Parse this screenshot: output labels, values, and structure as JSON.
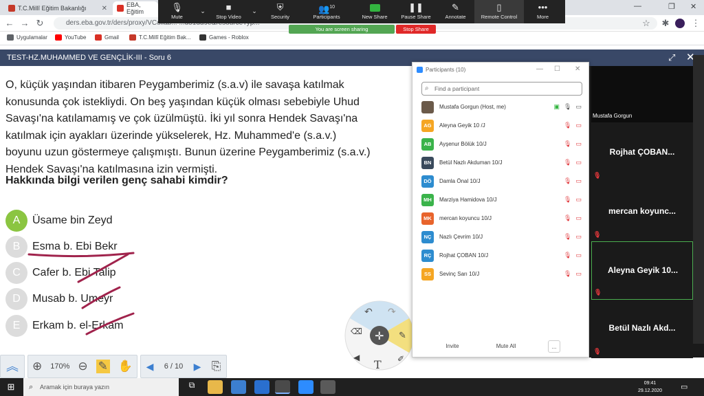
{
  "browser": {
    "tabs": [
      {
        "label": "T.C.Millî Eğitim Bakanlığı",
        "color": "#c53929"
      },
      {
        "label": "EBA, Eğitim",
        "color": "#d93025"
      }
    ],
    "url": "ders.eba.gov.tr/ders/proxy/VCollab...   ...d51dd9e&resourceTyp...",
    "bookmarks": [
      {
        "label": "Uygulamalar",
        "color": "#5f6368"
      },
      {
        "label": "YouTube",
        "color": "#ff0000"
      },
      {
        "label": "Gmail",
        "color": "#d93025"
      },
      {
        "label": "T.C.Millî Eğitim Bak...",
        "color": "#c53929"
      },
      {
        "label": "Games - Roblox",
        "color": "#333333"
      }
    ]
  },
  "zoom": {
    "toolbar": [
      {
        "label": "Mute",
        "icon": "🎙"
      },
      {
        "label": "Stop Video",
        "icon": "▶"
      },
      {
        "label": "Security",
        "icon": "🛡"
      },
      {
        "label": "Participants",
        "icon": "👥",
        "count": "10"
      },
      {
        "label": "New Share",
        "icon": "share"
      },
      {
        "label": "Pause Share",
        "icon": "❚❚"
      },
      {
        "label": "Annotate",
        "icon": "✎"
      },
      {
        "label": "Remote Control",
        "icon": "🖱"
      },
      {
        "label": "More",
        "icon": "•••"
      }
    ],
    "sharing_text": "You are screen sharing",
    "stop_share": "Stop Share"
  },
  "quiz": {
    "title": "TEST-HZ.MUHAMMED VE GENÇLİK-III - Soru 6",
    "question_lines": [
      "O, küçük yaşından itibaren Peygamberimiz (s.a.v) ile savaşa katılmak",
      "konusunda çok istekliydi. On beş yaşından küçük olması sebebiyle Uhud",
      "Savaşı'na katılamamış ve çok üzülmüştü. İki yıl sonra Hendek Savaşı'na",
      "katılmak için ayakları üzerinde yükselerek, Hz. Muhammed'e (s.a.v.)",
      "boyunu uzun göstermeye çalışmıştı. Bunun üzerine Peygamberimiz (s.a.v.)",
      "Hendek Savaşı'na katılmasına izin vermişti."
    ],
    "question_bold": "Hakkında bilgi verilen genç sahabi kimdir?",
    "options": [
      {
        "letter": "A",
        "text": "Üsame bin Zeyd",
        "selected": true
      },
      {
        "letter": "B",
        "text": "Esma b. Ebi Bekr",
        "selected": false
      },
      {
        "letter": "C",
        "text": "Cafer b. Ebi Talip",
        "selected": false
      },
      {
        "letter": "D",
        "text": "Musab b. Umeyr",
        "selected": false
      },
      {
        "letter": "E",
        "text": "Erkam b. el-Erkam",
        "selected": false
      }
    ],
    "annotation_color": "#a0234c"
  },
  "player": {
    "zoom_level": "170%",
    "page": "6 / 10"
  },
  "participants": {
    "title": "Participants (10)",
    "search_placeholder": "Find a participant",
    "list": [
      {
        "initials": "",
        "name": "Mustafa Gorgun (Host, me)",
        "color": "#6b5a4a",
        "host": true
      },
      {
        "initials": "AG",
        "name": "Aleyna Geyik 10 /J",
        "color": "#f5a623"
      },
      {
        "initials": "AB",
        "name": "Ayşenur Bölük 10/J",
        "color": "#3ab34a"
      },
      {
        "initials": "BN",
        "name": "Betül Nazlı Akduman 10/J",
        "color": "#3a4a5c"
      },
      {
        "initials": "DÖ",
        "name": "Damla Önal 10/J",
        "color": "#2d8ccf"
      },
      {
        "initials": "MH",
        "name": "Marziya Hamidova 10/J",
        "color": "#3ab34a"
      },
      {
        "initials": "MK",
        "name": "mercan koyuncu 10/J",
        "color": "#e8642c"
      },
      {
        "initials": "NÇ",
        "name": "Nazlı Çevrim 10/J",
        "color": "#2d8ccf"
      },
      {
        "initials": "RÇ",
        "name": "Rojhat ÇOBAN 10/J",
        "color": "#2d8ccf"
      },
      {
        "initials": "SS",
        "name": "Sevinç Sarı 10/J",
        "color": "#f5a623"
      }
    ],
    "buttons": {
      "invite": "Invite",
      "mute_all": "Mute All",
      "more": "..."
    }
  },
  "video_strip": {
    "host_name": "Mustafa Gorgun",
    "tiles": [
      "Rojhat  ÇOBAN...",
      "mercan  koyunc...",
      "Aleyna  Geyik  10...",
      "Betül  Nazlı  Akd..."
    ]
  },
  "taskbar": {
    "search_placeholder": "Aramak için buraya yazın",
    "time": "09:41",
    "date": "29.12.2020"
  }
}
